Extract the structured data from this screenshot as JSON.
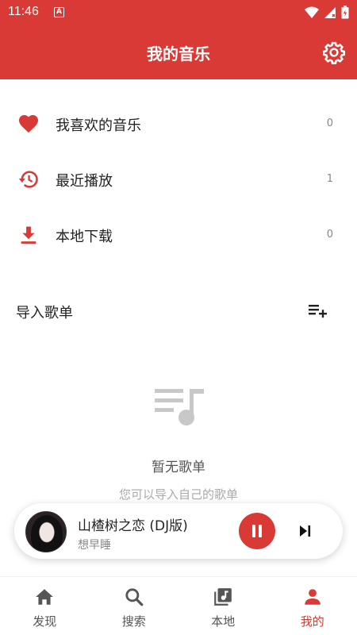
{
  "status_bar": {
    "time": "11:46",
    "notification_letter": "A"
  },
  "header": {
    "title": "我的音乐"
  },
  "menu": [
    {
      "label": "我喜欢的音乐",
      "count": "0",
      "icon": "heart-icon"
    },
    {
      "label": "最近播放",
      "count": "1",
      "icon": "history-icon"
    },
    {
      "label": "本地下载",
      "count": "0",
      "icon": "download-icon"
    }
  ],
  "playlists": {
    "title": "导入歌单",
    "empty_title": "暂无歌单",
    "empty_subtitle": "您可以导入自己的歌单"
  },
  "player": {
    "song_title": "山楂树之恋 (DJ版)",
    "artist": "想早睡",
    "state": "playing"
  },
  "nav": [
    {
      "label": "发现",
      "icon": "home-icon",
      "active": false
    },
    {
      "label": "搜索",
      "icon": "search-icon",
      "active": false
    },
    {
      "label": "本地",
      "icon": "music-library-icon",
      "active": false
    },
    {
      "label": "我的",
      "icon": "person-icon",
      "active": true
    }
  ],
  "colors": {
    "accent": "#d93a35",
    "inactive_nav": "#555555"
  }
}
